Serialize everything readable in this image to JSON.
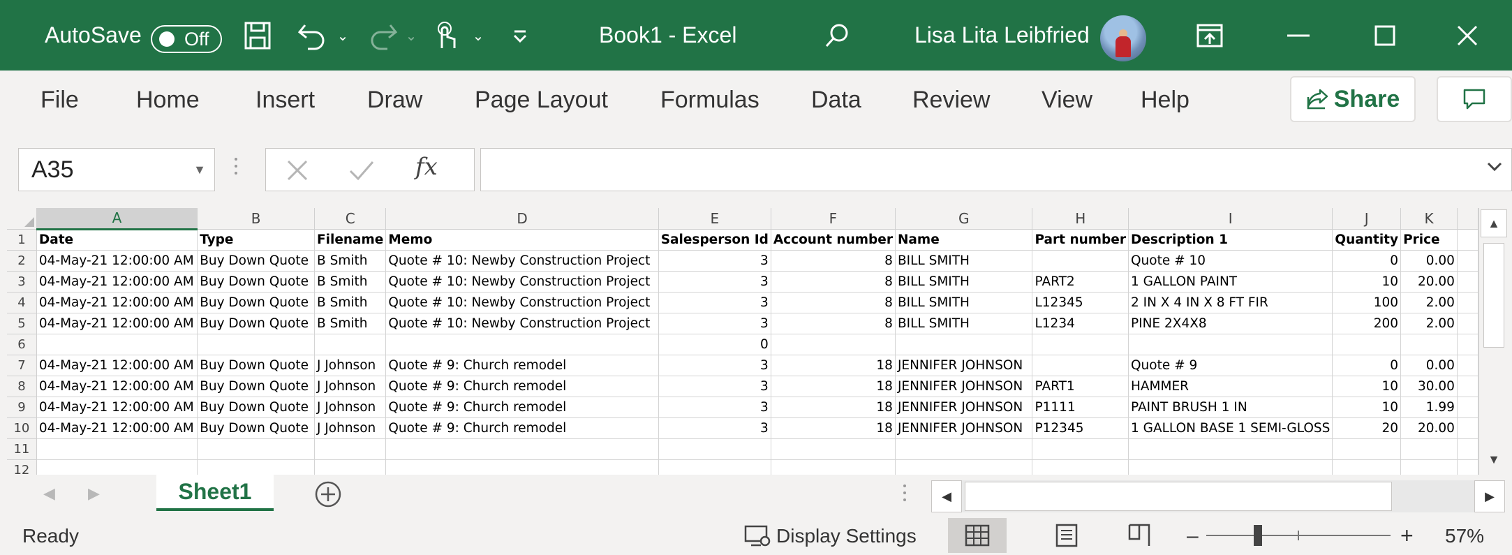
{
  "titlebar": {
    "autosave_label": "AutoSave",
    "autosave_state": "Off",
    "doc_title": "Book1  -  Excel",
    "user_name": "Lisa Lita Leibfried",
    "accent": "#217346"
  },
  "ribbon": {
    "tabs": [
      "File",
      "Home",
      "Insert",
      "Draw",
      "Page Layout",
      "Formulas",
      "Data",
      "Review",
      "View",
      "Help"
    ],
    "share_label": "Share"
  },
  "formula_bar": {
    "name_box": "A35",
    "fx_label": "fx",
    "formula_value": ""
  },
  "grid": {
    "selected_column": "A",
    "columns": [
      "A",
      "B",
      "C",
      "D",
      "E",
      "F",
      "G",
      "H",
      "I",
      "J",
      "K"
    ],
    "rows": [
      {
        "n": "1",
        "cells": [
          "Date",
          "Type",
          "Filename",
          "Memo",
          "Salesperson Id",
          "Account number",
          "Name",
          "Part number",
          "Description 1",
          "Quantity",
          "Price"
        ]
      },
      {
        "n": "2",
        "cells": [
          "04-May-21 12:00:00 AM",
          "Buy Down Quote",
          "B Smith",
          "Quote # 10: Newby Construction Project",
          "3",
          "8",
          "BILL SMITH",
          "",
          "Quote # 10",
          "0",
          "0.00"
        ]
      },
      {
        "n": "3",
        "cells": [
          "04-May-21 12:00:00 AM",
          "Buy Down Quote",
          "B Smith",
          "Quote # 10: Newby Construction Project",
          "3",
          "8",
          "BILL SMITH",
          "PART2",
          "1 GALLON PAINT",
          "10",
          "20.00"
        ]
      },
      {
        "n": "4",
        "cells": [
          "04-May-21 12:00:00 AM",
          "Buy Down Quote",
          "B Smith",
          "Quote # 10: Newby Construction Project",
          "3",
          "8",
          "BILL SMITH",
          "L12345",
          "2 IN X 4 IN X 8 FT FIR",
          "100",
          "2.00"
        ]
      },
      {
        "n": "5",
        "cells": [
          "04-May-21 12:00:00 AM",
          "Buy Down Quote",
          "B Smith",
          "Quote # 10: Newby Construction Project",
          "3",
          "8",
          "BILL SMITH",
          "L1234",
          "PINE 2X4X8",
          "200",
          "2.00"
        ]
      },
      {
        "n": "6",
        "cells": [
          "",
          "",
          "",
          "",
          "0",
          "",
          "",
          "",
          "",
          "",
          ""
        ]
      },
      {
        "n": "7",
        "cells": [
          "04-May-21 12:00:00 AM",
          "Buy Down Quote",
          "J Johnson",
          "Quote # 9: Church remodel",
          "3",
          "18",
          "JENNIFER JOHNSON",
          "",
          "Quote # 9",
          "0",
          "0.00"
        ]
      },
      {
        "n": "8",
        "cells": [
          "04-May-21 12:00:00 AM",
          "Buy Down Quote",
          "J Johnson",
          "Quote # 9: Church remodel",
          "3",
          "18",
          "JENNIFER JOHNSON",
          "PART1",
          "HAMMER",
          "10",
          "30.00"
        ]
      },
      {
        "n": "9",
        "cells": [
          "04-May-21 12:00:00 AM",
          "Buy Down Quote",
          "J Johnson",
          "Quote # 9: Church remodel",
          "3",
          "18",
          "JENNIFER JOHNSON",
          "P1111",
          "PAINT BRUSH 1 IN",
          "10",
          "1.99"
        ]
      },
      {
        "n": "10",
        "cells": [
          "04-May-21 12:00:00 AM",
          "Buy Down Quote",
          "J Johnson",
          "Quote # 9: Church remodel",
          "3",
          "18",
          "JENNIFER JOHNSON",
          "P12345",
          "1 GALLON BASE 1 SEMI-GLOSS",
          "20",
          "20.00"
        ]
      },
      {
        "n": "11",
        "cells": [
          "",
          "",
          "",
          "",
          "",
          "",
          "",
          "",
          "",
          "",
          ""
        ]
      },
      {
        "n": "12",
        "cells": [
          "",
          "",
          "",
          "",
          "",
          "",
          "",
          "",
          "",
          "",
          ""
        ]
      }
    ]
  },
  "sheets": {
    "active": "Sheet1"
  },
  "statusbar": {
    "status": "Ready",
    "display_settings": "Display Settings",
    "zoom": "57%"
  }
}
